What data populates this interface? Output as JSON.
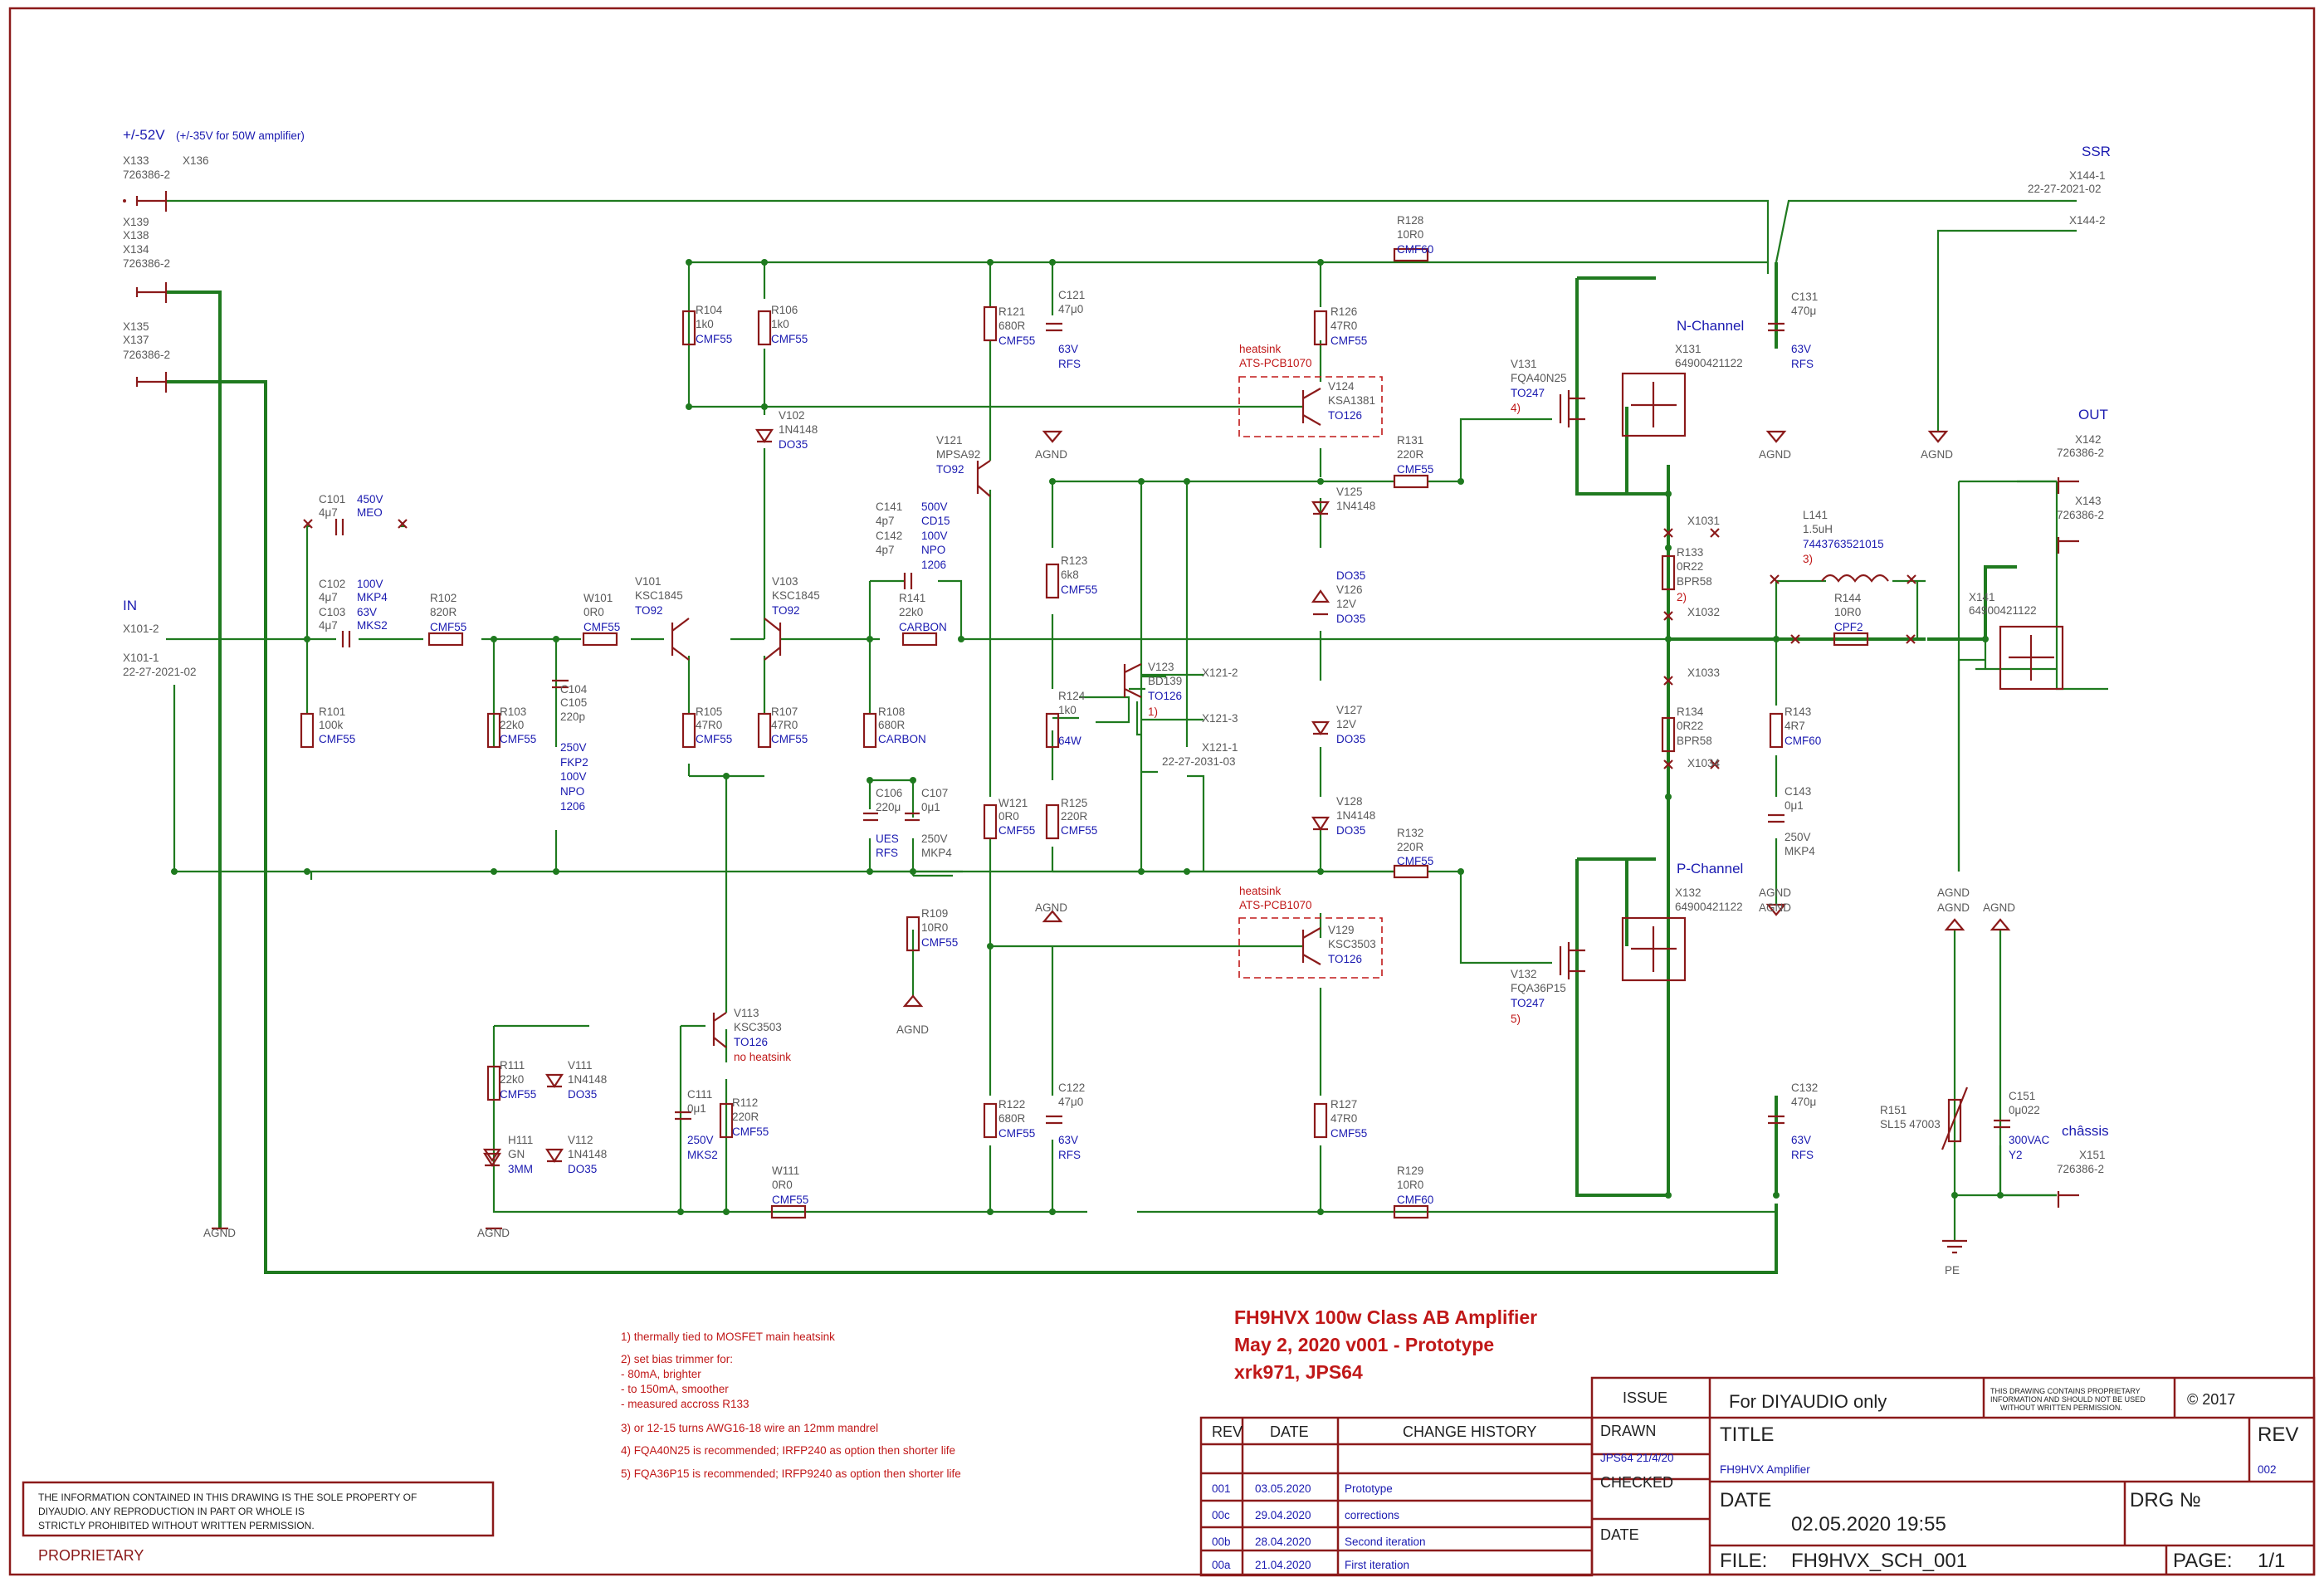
{
  "supply": {
    "label": "+/-52V",
    "note": "(+/-35V for 50W amplifier)"
  },
  "connectors": {
    "x133": "X133",
    "x136": "X136",
    "p726386_a": "726386-2",
    "x139": "X139",
    "x138": "X138",
    "x134": "X134",
    "p726386_b": "726386-2",
    "x135": "X135",
    "x137": "X137",
    "p726386_c": "726386-2",
    "ssr": "SSR",
    "x144_1": "X144-1",
    "x144_p": "22-27-2021-02",
    "x144_2": "X144-2",
    "in": "IN",
    "x101_2": "X101-2",
    "x101_1": "X101-1",
    "x101_p": "22-27-2021-02",
    "out": "OUT",
    "x142": "X142",
    "x142_p": "726386-2",
    "x143": "X143",
    "x143_p": "726386-2",
    "x121_2": "X121-2",
    "x121_3": "X121-3",
    "x121_1": "X121-1",
    "x121_p": "22-27-2031-03",
    "x141": "X141",
    "x141_p": "64900421122",
    "chassis": "châssis",
    "x151": "X151",
    "x151_p": "726386-2",
    "x1031": "X1031",
    "x1032": "X1032",
    "x1033": "X1033",
    "x1034": "X1034"
  },
  "parts": {
    "c101": "C101",
    "c101_v": "4μ7",
    "c101_v2": "450V",
    "c101_t": "MEO",
    "c102": "C102",
    "c102_v": "4μ7",
    "c102_v2": "100V",
    "c102_t": "MKP4",
    "c103": "C103",
    "c103_v": "4μ7",
    "c103_v2": "63V",
    "c103_t": "MKS2",
    "r101": "R101",
    "r101_v": "100k",
    "r101_t": "CMF55",
    "r102": "R102",
    "r102_v": "820R",
    "r102_t": "CMF55",
    "r103": "R103",
    "r103_v": "22k0",
    "r103_t": "CMF55",
    "c104": "C104",
    "c105": "C105",
    "c105_v": "220p",
    "c105_v2": "250V",
    "c105_t": "FKP2",
    "c105_v3": "100V",
    "c105_t2": "NPO",
    "c105_t3": "1206",
    "w101": "W101",
    "w101_v": "0R0",
    "w101_t": "CMF55",
    "v101": "V101",
    "v101_v": "KSC1845",
    "v101_t": "TO92",
    "v103": "V103",
    "v103_v": "KSC1845",
    "v103_t": "TO92",
    "r104": "R104",
    "r104_v": "1k0",
    "r104_t": "CMF55",
    "r106": "R106",
    "r106_v": "1k0",
    "r106_t": "CMF55",
    "v102": "V102",
    "v102_v": "1N4148",
    "v102_t": "DO35",
    "r105": "R105",
    "r105_v": "47R0",
    "r105_t": "CMF55",
    "r107": "R107",
    "r107_v": "47R0",
    "r107_t": "CMF55",
    "c141": "C141",
    "c141_v": "4p7",
    "c142": "C142",
    "c142_v": "4p7",
    "c141_v2": "500V",
    "c141_t": "CD15",
    "c142_v2": "100V",
    "c142_t": "NPO",
    "c142_t2": "1206",
    "r141": "R141",
    "r141_v": "22k0",
    "r141_t": "CARBON",
    "r108": "R108",
    "r108_v": "680R",
    "r108_t": "CARBON",
    "c106": "C106",
    "c106_v": "220μ",
    "c106_t": "UES",
    "c106_t2": "RFS",
    "c107": "C107",
    "c107_v": "0μ1",
    "c107_v2": "250V",
    "c107_t": "MKP4",
    "r109": "R109",
    "r109_v": "10R0",
    "r109_t": "CMF55",
    "v121": "V121",
    "v121_v": "MPSA92",
    "v121_t": "TO92",
    "r121": "R121",
    "r121_v": "680R",
    "r121_t": "CMF55",
    "c121": "C121",
    "c121_v": "47μ0",
    "c121_v2": "63V",
    "c121_t": "RFS",
    "r123": "R123",
    "r123_v": "6k8",
    "r123_t": "CMF55",
    "r124": "R124",
    "r124_v": "1k0",
    "r124_t": "64W",
    "v123": "V123",
    "v123_v": "BD139",
    "v123_t": "TO126",
    "v123_n": "1)",
    "w121": "W121",
    "w121_v": "0R0",
    "w121_t": "CMF55",
    "r125": "R125",
    "r125_v": "220R",
    "r125_t": "CMF55",
    "r122": "R122",
    "r122_v": "680R",
    "r122_t": "CMF55",
    "c122": "C122",
    "c122_v": "47μ0",
    "c122_v2": "63V",
    "c122_t": "RFS",
    "r126": "R126",
    "r126_v": "47R0",
    "r126_t": "CMF55",
    "hs1": "heatsink",
    "hs1_p": "ATS-PCB1070",
    "v124": "V124",
    "v124_v": "KSA1381",
    "v124_t": "TO126",
    "v125": "V125",
    "v125_v": "1N4148",
    "v126": "V126",
    "v126_v": "12V",
    "v126_t": "DO35",
    "v126_t0": "DO35",
    "v127": "V127",
    "v127_v": "12V",
    "v127_t": "DO35",
    "v128": "V128",
    "v128_v": "1N4148",
    "v128_t": "DO35",
    "hs2": "heatsink",
    "hs2_p": "ATS-PCB1070",
    "v129": "V129",
    "v129_v": "KSC3503",
    "v129_t": "TO126",
    "r127": "R127",
    "r127_v": "47R0",
    "r127_t": "CMF55",
    "r128": "R128",
    "r128_v": "10R0",
    "r128_t": "CMF60",
    "r129": "R129",
    "r129_v": "10R0",
    "r129_t": "CMF60",
    "r131": "R131",
    "r131_v": "220R",
    "r131_t": "CMF55",
    "r132": "R132",
    "r132_v": "220R",
    "r132_t": "CMF55",
    "v131": "V131",
    "v131_v": "FQA40N25",
    "v131_t": "TO247",
    "v131_n": "4)",
    "v132": "V132",
    "v132_v": "FQA36P15",
    "v132_t": "TO247",
    "v132_n": "5)",
    "x131": "X131",
    "x131_v": "64900421122",
    "nch": "N-Channel",
    "x132": "X132",
    "x132_v": "64900421122",
    "pch": "P-Channel",
    "c131": "C131",
    "c131_v": "470μ",
    "c131_v2": "63V",
    "c131_t": "RFS",
    "c132": "C132",
    "c132_v": "470μ",
    "c132_v2": "63V",
    "c132_t": "RFS",
    "r133": "R133",
    "r133_v": "0R22",
    "r133_t": "BPR58",
    "r133_n": "2)",
    "r134": "R134",
    "r134_v": "0R22",
    "r134_t": "BPR58",
    "l141": "L141",
    "l141_v": "1.5uH",
    "l141_p": "7443763521015",
    "l141_n": "3)",
    "r144": "R144",
    "r144_v": "10R0",
    "r144_t": "CPF2",
    "r143": "R143",
    "r143_v": "4R7",
    "r143_t": "CMF60",
    "c143": "C143",
    "c143_v": "0μ1",
    "c143_v2": "250V",
    "c143_t": "MKP4",
    "r151": "R151",
    "r151_v": "SL15 47003",
    "c151": "C151",
    "c151_v": "0μ022",
    "c151_v2": "300VAC",
    "c151_t": "Y2",
    "r111": "R111",
    "r111_v": "22k0",
    "r111_t": "CMF55",
    "v111": "V111",
    "v111_v": "1N4148",
    "v111_t": "DO35",
    "v112": "V112",
    "v112_v": "1N4148",
    "v112_t": "DO35",
    "h111": "H111",
    "h111_v": "GN",
    "h111_t": "3MM",
    "v113": "V113",
    "v113_v": "KSC3503",
    "v113_t": "TO126",
    "v113_n": "no heatsink",
    "c111": "C111",
    "c111_v": "0μ1",
    "c111_v2": "250V",
    "c111_t": "MKS2",
    "r112": "R112",
    "r112_v": "220R",
    "r112_t": "CMF55",
    "w111": "W111",
    "w111_v": "0R0",
    "w111_t": "CMF55"
  },
  "grounds": {
    "agnd": "AGND",
    "pe": "PE"
  },
  "notes": [
    "1) thermally tied to MOSFET main heatsink",
    "2) set bias trimmer for:",
    "- 80mA, brighter",
    "- to 150mA, smoother",
    "- measured accross R133",
    "3) or 12-15 turns AWG16-18 wire an 12mm mandrel",
    "4) FQA40N25 is recommended; IRFP240 as option then shorter life",
    "5) FQA36P15 is recommended; IRFP9240 as option then shorter life"
  ],
  "heading": {
    "line1": "FH9HVX  100w Class AB Amplifier",
    "line2": "May 2, 2020  v001  - Prototype",
    "line3": "xrk971, JPS64"
  },
  "proprietary": {
    "text1": "THE INFORMATION CONTAINED IN THIS DRAWING IS THE SOLE PROPERTY OF",
    "text2": "DIYAUDIO.  ANY REPRODUCTION IN PART OR WHOLE IS",
    "text3": "STRICTLY PROHIBITED WITHOUT WRITTEN PERMISSION.",
    "label": "PROPRIETARY"
  },
  "history": {
    "col_rev": "REV",
    "col_date": "DATE",
    "col_change": "CHANGE HISTORY",
    "rows": [
      {
        "rev": "001",
        "date": "03.05.2020",
        "change": "Prototype"
      },
      {
        "rev": "00c",
        "date": "29.04.2020",
        "change": "corrections"
      },
      {
        "rev": "00b",
        "date": "28.04.2020",
        "change": "Second iteration"
      },
      {
        "rev": "00a",
        "date": "21.04.2020",
        "change": "First iteration"
      }
    ]
  },
  "titleblock": {
    "issue": "ISSUE",
    "for": "For DIYAUDIO only",
    "prop1": "THIS DRAWING CONTAINS PROPRIETARY",
    "prop2": "INFORMATION AND SHOULD NOT BE USED",
    "prop3": "WITHOUT WRITTEN PERMISSION.",
    "copyright": "© 2017",
    "drawn": "DRAWN",
    "drawn_by": "JPS64 21/4/20",
    "checked": "CHECKED",
    "date_lbl": "DATE",
    "title_lbl": "TITLE",
    "title": "FH9HVX Amplifier",
    "rev_lbl": "REV",
    "rev": "002",
    "date_lbl2": "DATE",
    "date": "02.05.2020 19:55",
    "drg": "DRG №",
    "file_lbl": "FILE:",
    "file": "FH9HVX_SCH_001",
    "page_lbl": "PAGE:",
    "page": "1/1"
  }
}
